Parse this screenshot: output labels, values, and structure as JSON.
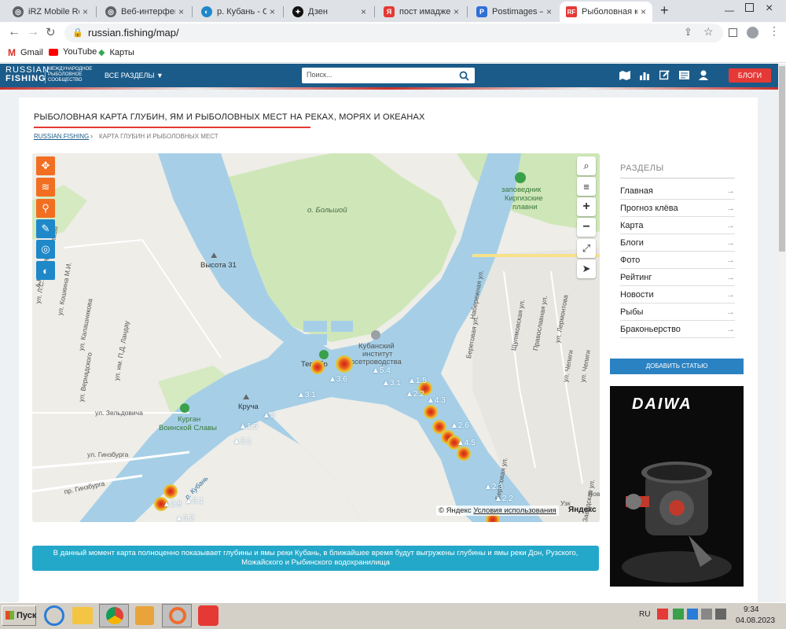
{
  "browser": {
    "tabs": [
      {
        "label": "iRZ Mobile Router",
        "icon": "globe-icon"
      },
      {
        "label": "Веб-интерфейс",
        "icon": "globe-icon"
      },
      {
        "label": "р. Кубань - Стра",
        "icon": "fishing-icon"
      },
      {
        "label": "Дзен",
        "icon": "zen-icon"
      },
      {
        "label": "пост имадже — Я",
        "icon": "yandex-icon"
      },
      {
        "label": "Postimages — fre",
        "icon": "postimages-icon"
      },
      {
        "label": "Рыболовная карт",
        "icon": "rf-icon",
        "active": true
      }
    ],
    "new_tab": "+",
    "url": "russian.fishing/map/",
    "bookmarks": [
      {
        "label": "Gmail",
        "icon": "gmail-icon"
      },
      {
        "label": "YouTube",
        "icon": "youtube-icon"
      },
      {
        "label": "Карты",
        "icon": "maps-icon"
      }
    ]
  },
  "site": {
    "logo_top": "RUSSIAN",
    "logo_bottom": "FISHING",
    "logo_sub1": "МЕЖДУНАРОДНОЕ",
    "logo_sub2": "РЫБОЛОВНОЕ",
    "logo_sub3": "СООБЩЕСТВО",
    "sections_menu": "ВСЕ РАЗДЕЛЫ ▼",
    "search_placeholder": "Поиск...",
    "blogs_button": "БЛОГИ"
  },
  "page": {
    "title": "РЫБОЛОВНАЯ КАРТА ГЛУБИН, ЯМ И РЫБОЛОВНЫХ МЕСТ НА РЕКАХ, МОРЯХ И ОКЕАНАХ",
    "breadcrumb_home": "RUSSIAN.FISHING",
    "breadcrumb_sep": "›",
    "breadcrumb_current": "КАРТА ГЛУБИН И РЫБОЛОВНЫХ МЕСТ",
    "info_text": "В данный момент карта полноценно показывает глубины и ямы реки Кубань, в ближайшее время будут выгружены глубины и ямы реки Дон, Рузского, Можайского и Рыбинского водохранилища"
  },
  "map": {
    "places": {
      "bolshoy": "о. Большой",
      "zapovednik1": "заповедник",
      "zapovednik2": "Киргизские",
      "zapovednik3": "плавни",
      "vysota": "Высота 31",
      "kubinst1": "Кубанский",
      "kubinst2": "институт",
      "kubinst3": "осетроводства",
      "kruche": "Круча",
      "kurgan1": "Курган",
      "kurgan2": "Воинской Славы",
      "teploe": "Теп     сбр"
    },
    "streets": {
      "s1": "ул. Л.С. Полторына",
      "s2": "ул. Кошкина М.И.",
      "s3": "ул. Калашникова",
      "s4": "ул. им. П.Д. Ландау",
      "s5": "ул. Вернадского",
      "s6": "ул. Зельдовича",
      "s7": "ул. Гинзбурга",
      "s8": "пр. Гинзбурга",
      "s9": "р. Кубань",
      "s10": "Набережная ул.",
      "s11": "Береговая ул.",
      "s12": "Щуляковская ул.",
      "s13": "Православная ул.",
      "s14": "ул. Лермонтова",
      "s15": "ул. Чепиги",
      "s16": "ул. Чепиги",
      "s17": "Береговая ул.",
      "s18": "Заводская ул.",
      "s19": "А.Н.",
      "s20": "Славы",
      "s21": "Узк",
      "s22": "Нов"
    },
    "depths": [
      "5.4",
      "3.6",
      "3.1",
      "1.5",
      "2.2",
      "3.1",
      "1.5",
      "3.1",
      "2.8",
      "3.1",
      "3.2",
      "4.3",
      "2.6",
      "4.5",
      "2.3",
      "2.2",
      "3"
    ],
    "copyright": "© Яндекс",
    "terms": "Условия использования",
    "yandex": "Яндекс"
  },
  "sidebar": {
    "heading": "РАЗДЕЛЫ",
    "items": [
      "Главная",
      "Прогноз клёва",
      "Карта",
      "Блоги",
      "Фото",
      "Рейтинг",
      "Новости",
      "Рыбы",
      "Браконьерство"
    ],
    "arrow": "→",
    "add_article": "ДОБАВИТЬ СТАТЬЮ",
    "ad_brand": "DAIWA"
  },
  "taskbar": {
    "start": "Пуск",
    "lang": "RU",
    "time": "9:34",
    "date": "04.08.2023"
  },
  "colors": {
    "header_blue": "#1b5b89",
    "accent_orange": "#f26f21",
    "map_water": "#a6cfe7",
    "map_green": "#cfe7b8",
    "info_blue": "#24a8c9",
    "blog_red": "#e53935"
  }
}
